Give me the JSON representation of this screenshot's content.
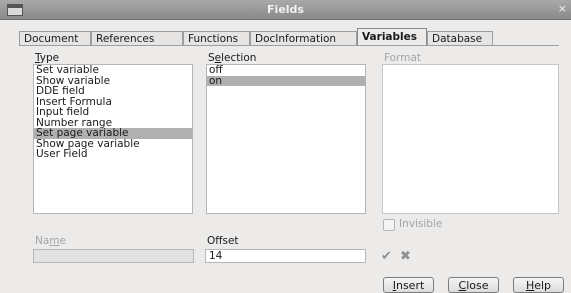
{
  "window": {
    "title": "Fields",
    "close_glyph": "×"
  },
  "tabs": [
    {
      "label": "Document"
    },
    {
      "label": "References"
    },
    {
      "label": "Functions"
    },
    {
      "label": "DocInformation"
    },
    {
      "label": "Variables",
      "active": true
    },
    {
      "label": "Database"
    }
  ],
  "type": {
    "label": "Type",
    "items": [
      "Set variable",
      "Show variable",
      "DDE field",
      "Insert Formula",
      "Input field",
      "Number range",
      "Set page variable",
      "Show page variable",
      "User Field"
    ],
    "selected": "Set page variable"
  },
  "selection": {
    "label": "Selection",
    "items": [
      "off",
      "on"
    ],
    "selected": "on"
  },
  "format": {
    "label": "Format"
  },
  "invisible": {
    "label": "Invisible",
    "checked": false
  },
  "name": {
    "label": "Name",
    "value": ""
  },
  "offset": {
    "label": "Offset",
    "value": "14"
  },
  "buttons": {
    "insert": "Insert",
    "close": "Close",
    "help": "Help"
  },
  "icons": {
    "apply": "checkmark-icon",
    "delete": "delete-x-icon"
  },
  "colors": {
    "selection_highlight": "#b0b0b0",
    "titlebar": "#999999"
  }
}
